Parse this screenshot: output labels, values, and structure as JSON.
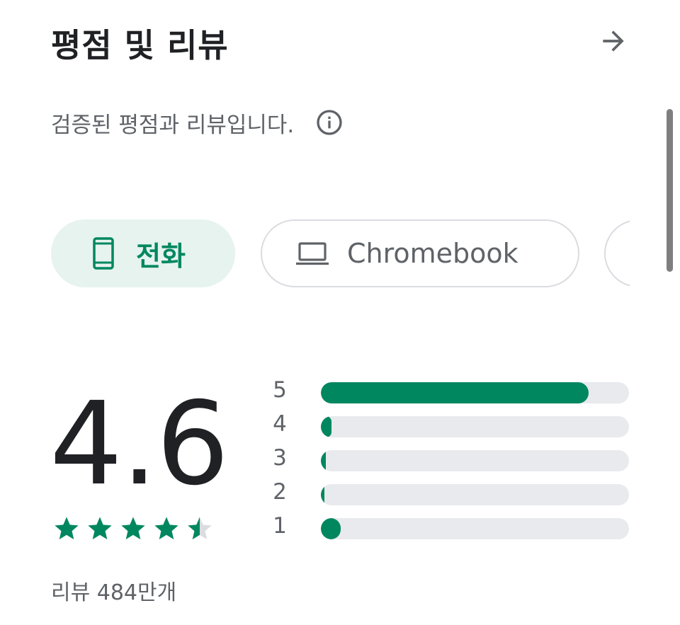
{
  "header": {
    "title": "평점 및 리뷰",
    "arrow_icon": "arrow-right-icon"
  },
  "subtitle": {
    "text": "검증된 평점과 리뷰입니다.",
    "info_icon": "info-icon"
  },
  "chips": [
    {
      "label": "전화",
      "icon": "phone-icon",
      "selected": true
    },
    {
      "label": "Chromebook",
      "icon": "laptop-icon",
      "selected": false
    },
    {
      "label": "",
      "icon": "",
      "selected": false,
      "partially_visible": true
    }
  ],
  "rating": {
    "score": "4.6",
    "stars_filled": 4.6,
    "review_count": "리뷰 484만개"
  },
  "histogram": [
    {
      "label": "5",
      "fraction": 0.87
    },
    {
      "label": "4",
      "fraction": 0.035
    },
    {
      "label": "3",
      "fraction": 0.017
    },
    {
      "label": "2",
      "fraction": 0.012
    },
    {
      "label": "1",
      "fraction": 0.065
    }
  ],
  "colors": {
    "accent": "#01875f",
    "chip_selected_bg": "#e6f3ef",
    "track": "#e8eaed",
    "text_primary": "#202124",
    "text_secondary": "#5f6368"
  }
}
